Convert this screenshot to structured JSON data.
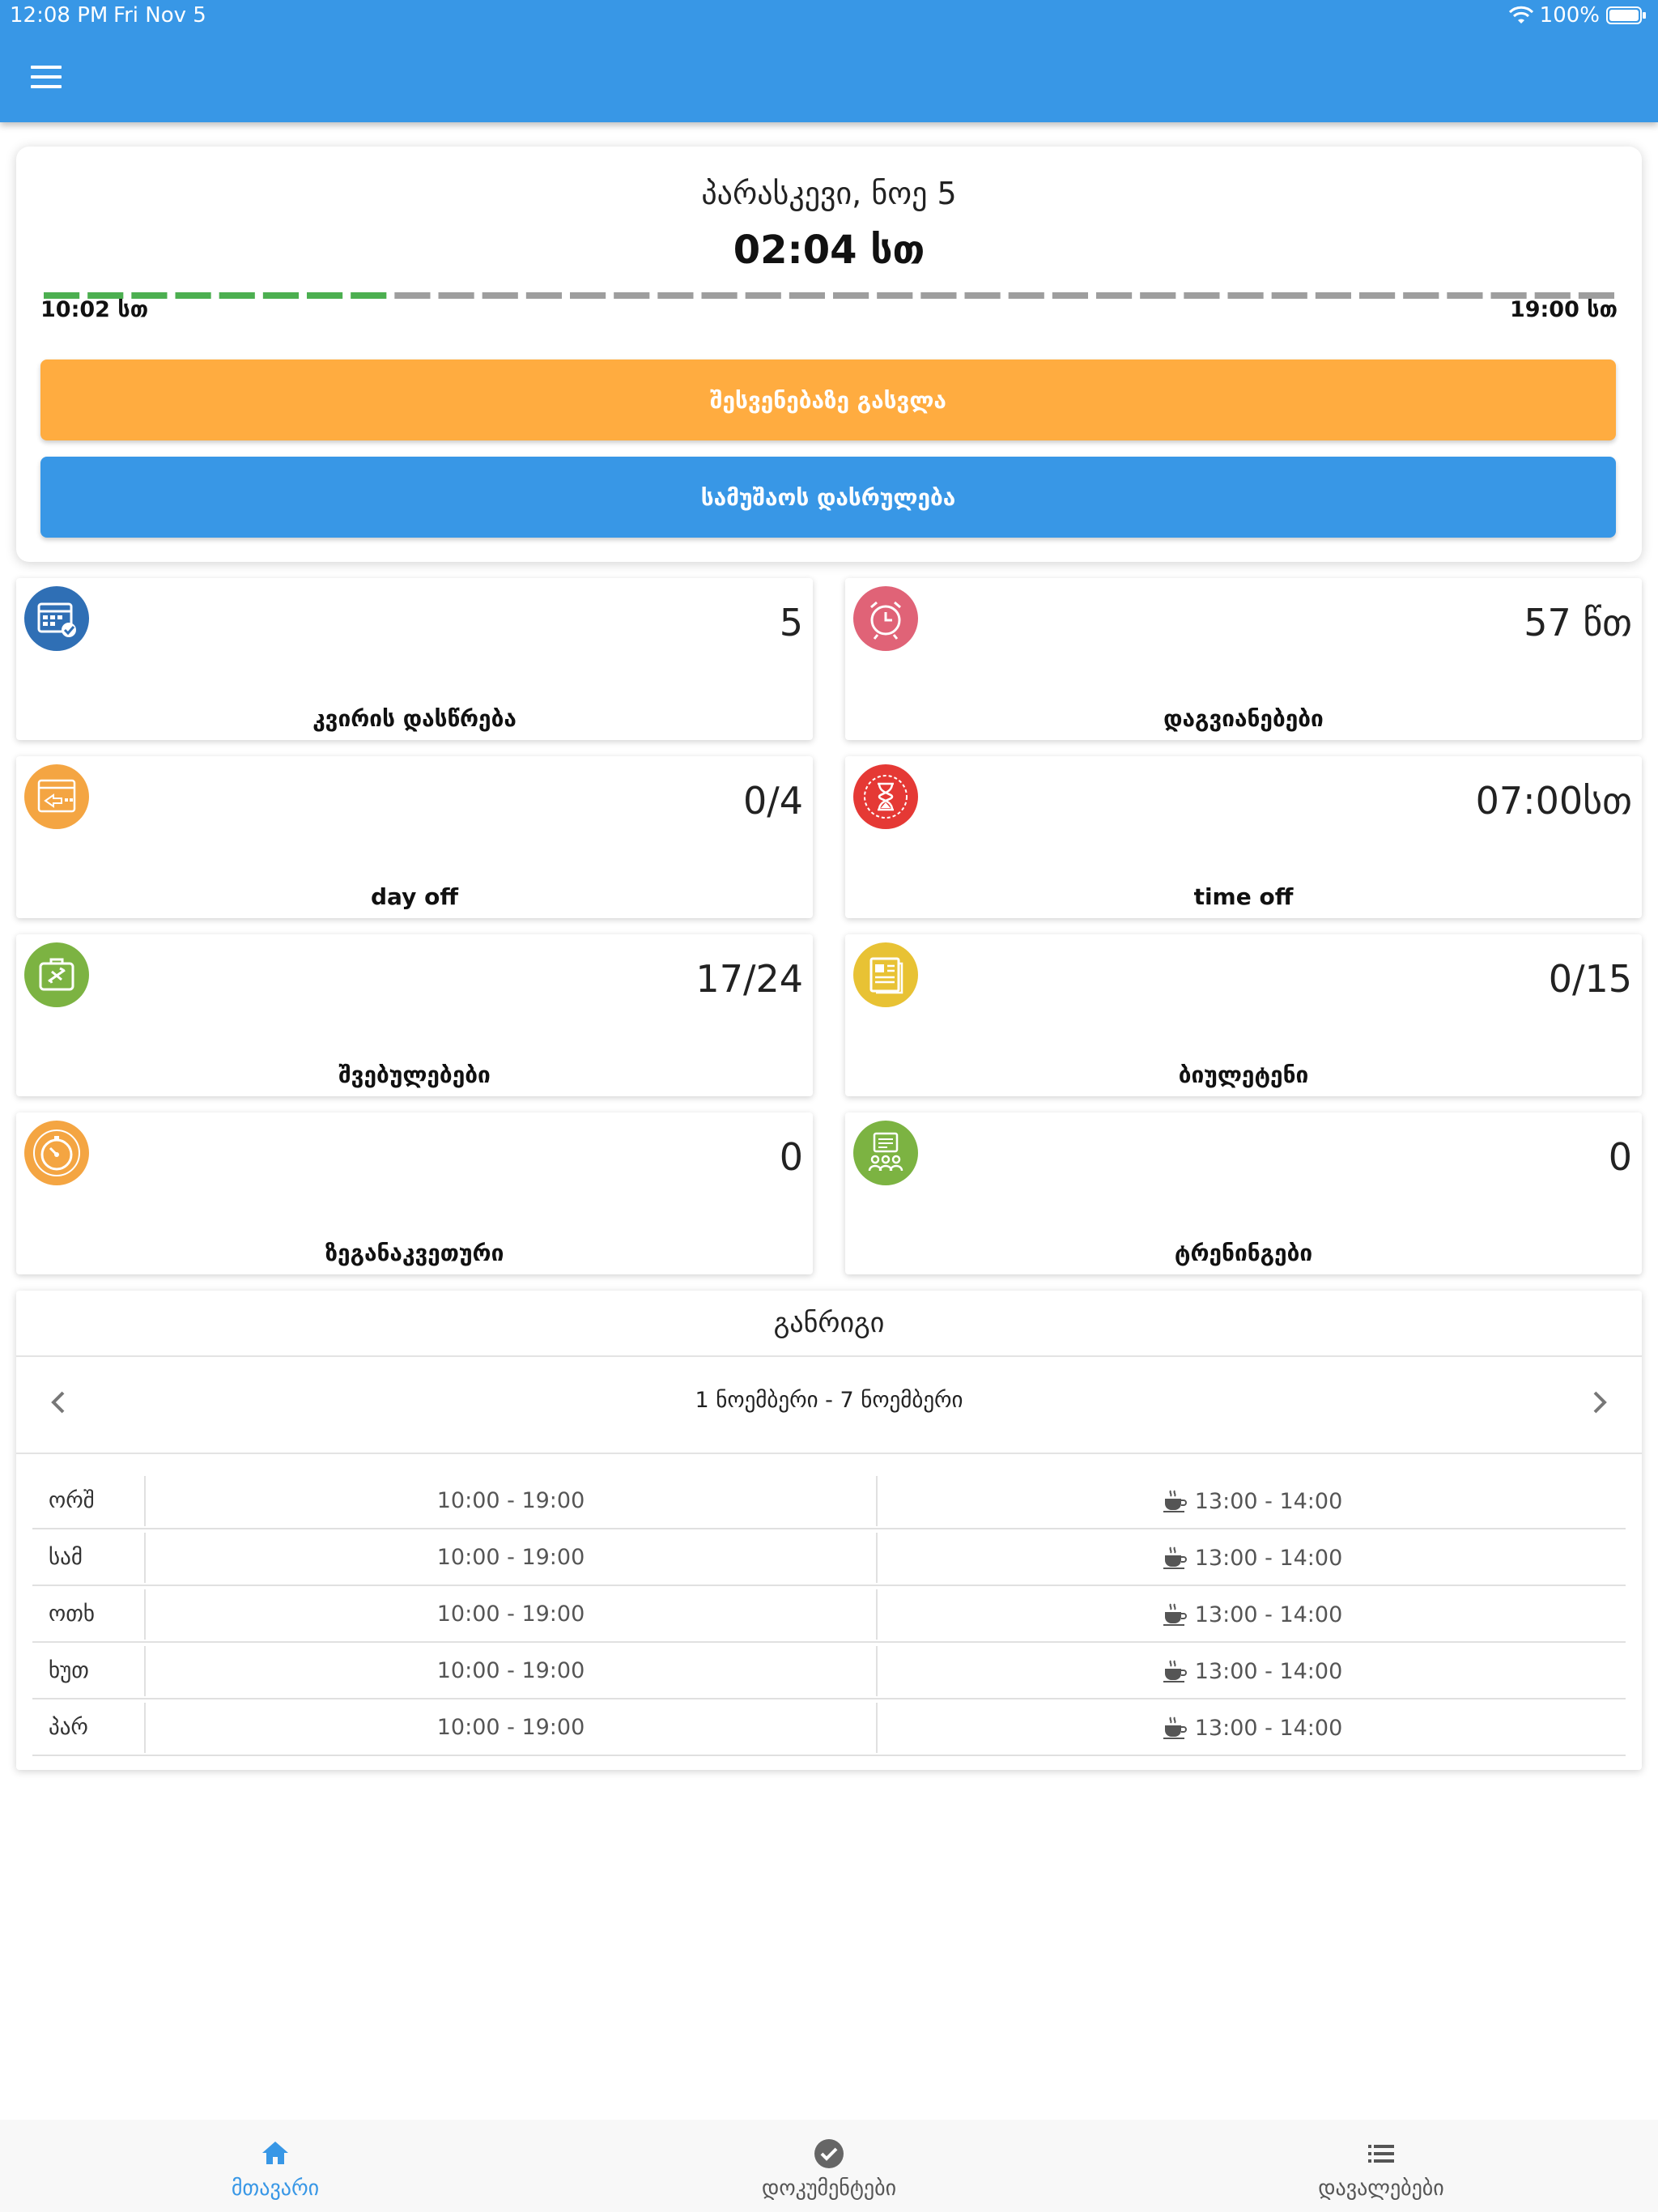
{
  "status_bar": {
    "time": "12:08 PM",
    "date": "Fri Nov 5",
    "battery": "100%"
  },
  "colors": {
    "primary": "#3897e6",
    "break_button": "#ffac40",
    "progress_done": "#4caf50",
    "progress_todo": "#9e9e9e"
  },
  "today": {
    "date": "პარასკევი, ნოე 5",
    "worked": "02:04 სთ",
    "start": "10:02 სთ",
    "end": "19:00 სთ",
    "progress_fraction": 0.233,
    "break_button": "შესვენებაზე გასვლა",
    "end_button": "სამუშაოს დასრულება"
  },
  "stats": [
    {
      "label": "კვირის დასწრება",
      "value": "5",
      "icon": "calendar-check-icon",
      "color": "#2f6fb5"
    },
    {
      "label": "დაგვიანებები",
      "value": "57 წთ",
      "icon": "alarm-clock-icon",
      "color": "#e06377"
    },
    {
      "label": "day off",
      "value": "0/4",
      "icon": "calendar-arrow-icon",
      "color": "#f4a542"
    },
    {
      "label": "time off",
      "value": "07:00სთ",
      "icon": "hourglass-icon",
      "color": "#e53935"
    },
    {
      "label": "შვებულებები",
      "value": "17/24",
      "icon": "suitcase-plane-icon",
      "color": "#7cb342"
    },
    {
      "label": "ბიულეტენი",
      "value": "0/15",
      "icon": "document-icon",
      "color": "#e8c234"
    },
    {
      "label": "ზეგანაკვეთური",
      "value": "0",
      "icon": "stopwatch-icon",
      "color": "#f4a542"
    },
    {
      "label": "ტრენინგები",
      "value": "0",
      "icon": "training-board-icon",
      "color": "#7cb342"
    }
  ],
  "schedule": {
    "title": "განრიგი",
    "week_range": "1 ნოემბერი - 7 ნოემბერი",
    "rows": [
      {
        "day": "ორშ",
        "hours": "10:00 - 19:00",
        "break": "13:00 - 14:00"
      },
      {
        "day": "სამ",
        "hours": "10:00 - 19:00",
        "break": "13:00 - 14:00"
      },
      {
        "day": "ოთხ",
        "hours": "10:00 - 19:00",
        "break": "13:00 - 14:00"
      },
      {
        "day": "ხუთ",
        "hours": "10:00 - 19:00",
        "break": "13:00 - 14:00"
      },
      {
        "day": "პარ",
        "hours": "10:00 - 19:00",
        "break": "13:00 - 14:00"
      }
    ]
  },
  "tabs": [
    {
      "label": "მთავარი",
      "icon": "home-icon",
      "active": true
    },
    {
      "label": "დოკუმენტები",
      "icon": "check-circle-icon",
      "active": false
    },
    {
      "label": "დავალებები",
      "icon": "list-icon",
      "active": false
    }
  ]
}
